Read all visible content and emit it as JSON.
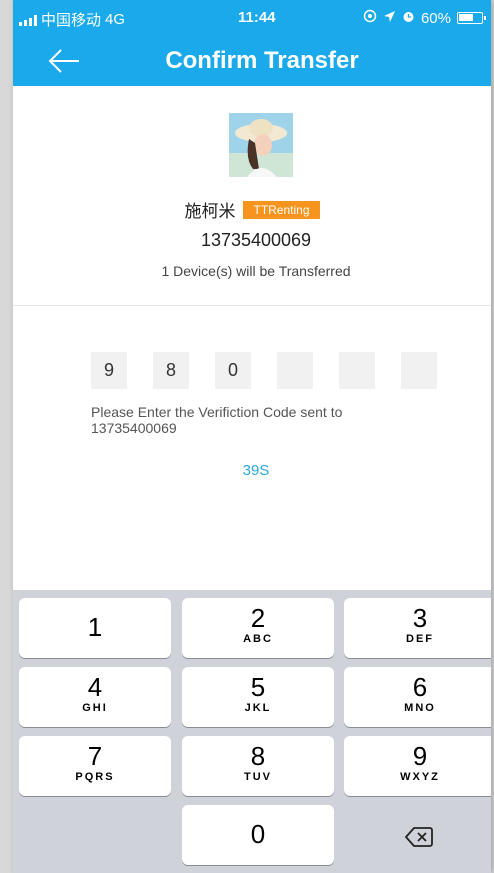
{
  "status_bar": {
    "carrier": "中国移动",
    "network": "4G",
    "time": "11:44",
    "battery": "60%"
  },
  "header": {
    "title": "Confirm Transfer"
  },
  "profile": {
    "name": "施柯米",
    "badge": "TTRenting",
    "phone": "13735400069",
    "devices_text": "1 Device(s) will be Transferred"
  },
  "verification": {
    "digits": [
      "9",
      "8",
      "0",
      "",
      "",
      ""
    ],
    "prompt": "Please Enter the Verifiction Code sent to 13735400069",
    "countdown": "39S"
  },
  "keypad": {
    "keys": [
      {
        "digit": "1",
        "letters": ""
      },
      {
        "digit": "2",
        "letters": "ABC"
      },
      {
        "digit": "3",
        "letters": "DEF"
      },
      {
        "digit": "4",
        "letters": "GHI"
      },
      {
        "digit": "5",
        "letters": "JKL"
      },
      {
        "digit": "6",
        "letters": "MNO"
      },
      {
        "digit": "7",
        "letters": "PQRS"
      },
      {
        "digit": "8",
        "letters": "TUV"
      },
      {
        "digit": "9",
        "letters": "WXYZ"
      },
      {
        "digit": "0",
        "letters": ""
      }
    ]
  },
  "colors": {
    "accent": "#1aaaec",
    "badge": "#f7941d",
    "countdown": "#29a9e1"
  }
}
